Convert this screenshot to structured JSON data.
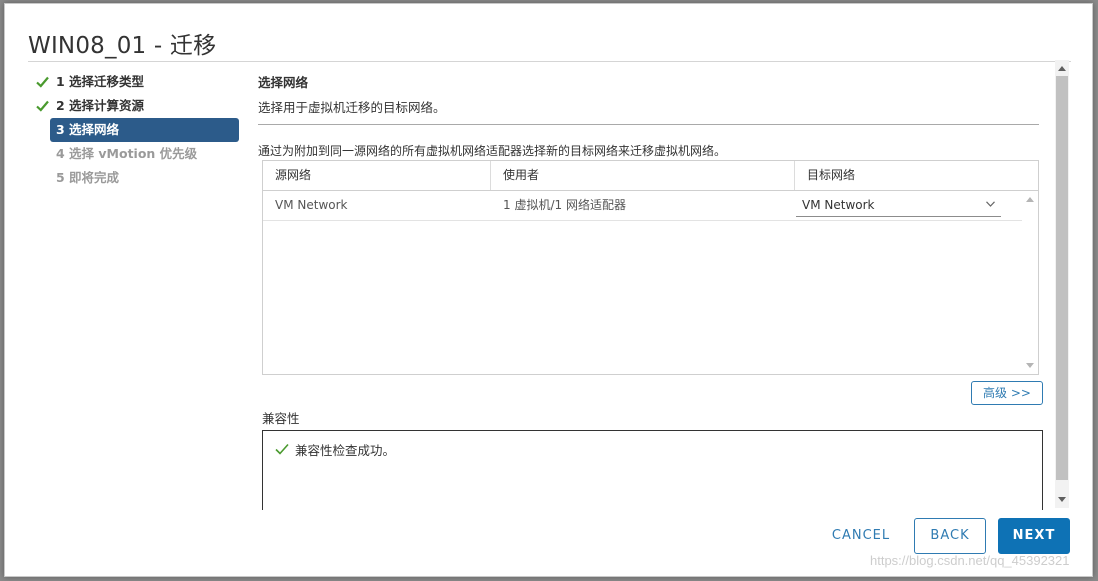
{
  "dialog": {
    "title": "WIN08_01 - 迁移"
  },
  "steps": [
    {
      "label": "1 选择迁移类型",
      "state": "done"
    },
    {
      "label": "2 选择计算资源",
      "state": "done"
    },
    {
      "label": "3 选择网络",
      "state": "active"
    },
    {
      "label": "4 选择 vMotion 优先级",
      "state": "pending"
    },
    {
      "label": "5 即将完成",
      "state": "pending"
    }
  ],
  "section": {
    "title": "选择网络",
    "description": "选择用于虚拟机迁移的目标网络。",
    "instruction": "通过为附加到同一源网络的所有虚拟机网络适配器选择新的目标网络来迁移虚拟机网络。"
  },
  "grid": {
    "headers": [
      "源网络",
      "使用者",
      "目标网络"
    ],
    "rows": [
      {
        "source": "VM Network",
        "used_by": "1 虚拟机/1 网络适配器",
        "target": "VM Network"
      }
    ]
  },
  "advanced_button": "高级 >>",
  "compatibility": {
    "label": "兼容性",
    "message": "兼容性检查成功。"
  },
  "footer": {
    "cancel": "CANCEL",
    "back": "BACK",
    "next": "NEXT"
  },
  "watermark": "https://blog.csdn.net/qq_45392321",
  "colors": {
    "accent": "#0e72b5",
    "active_step": "#2c5b8a",
    "success": "#4a9a2e"
  },
  "icons": [
    "check-icon",
    "chevron-down-icon"
  ]
}
